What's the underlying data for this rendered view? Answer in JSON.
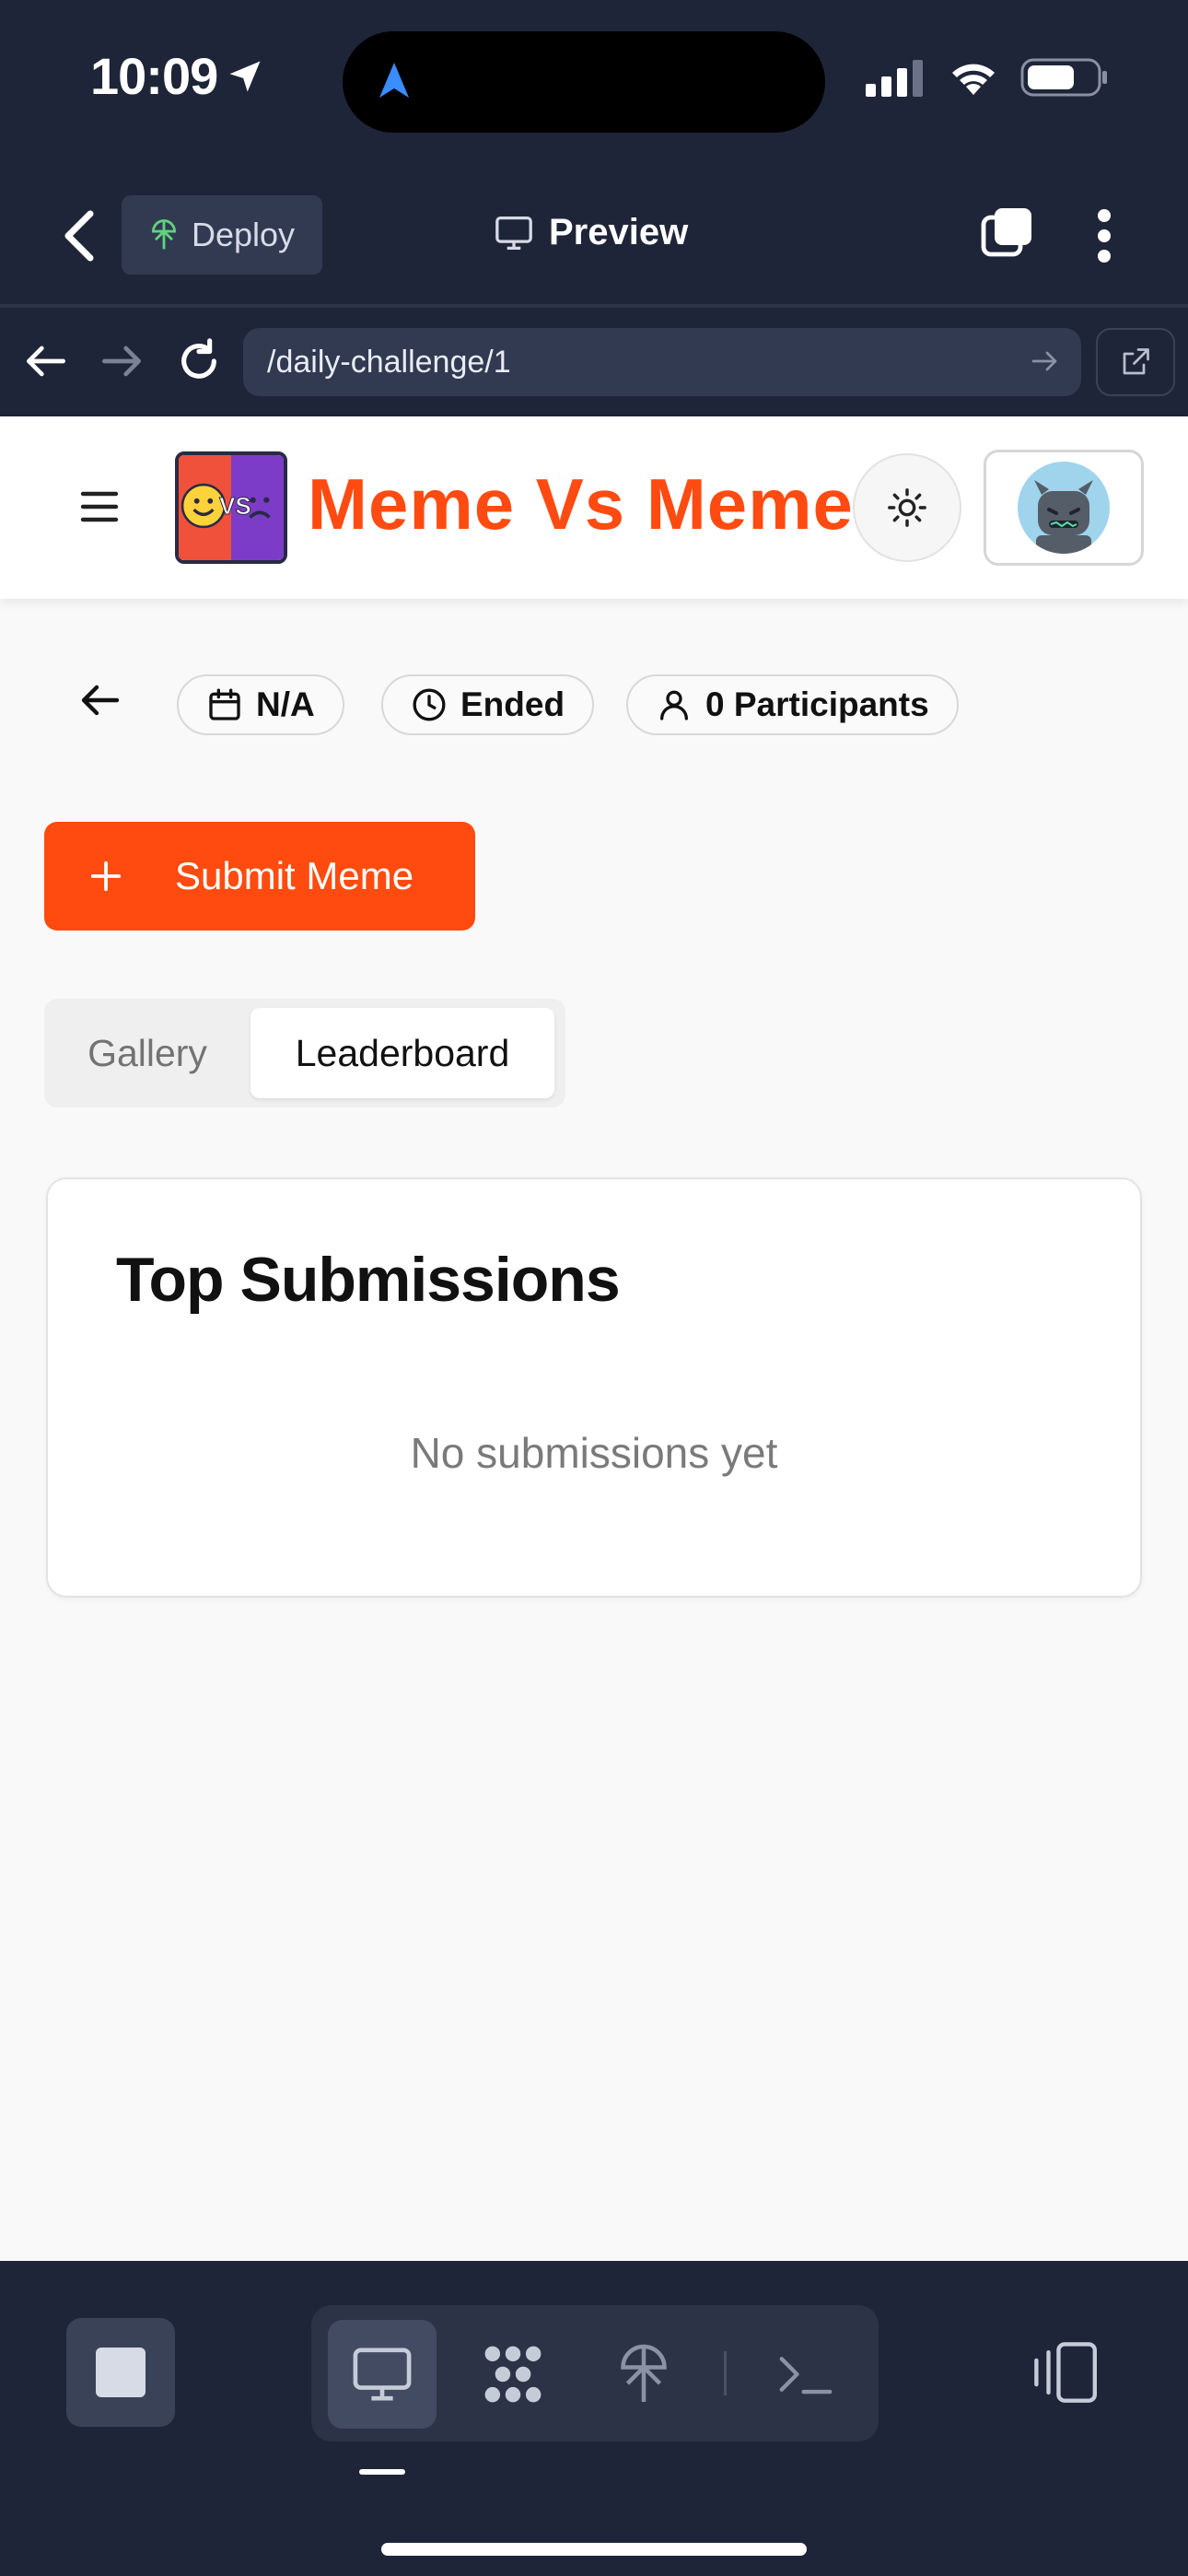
{
  "status_bar": {
    "time": "10:09"
  },
  "top_nav": {
    "deploy_label": "Deploy",
    "preview_label": "Preview"
  },
  "browser": {
    "url": "/daily-challenge/1"
  },
  "app": {
    "brand": "Meme Vs Meme",
    "logo_text": "VS"
  },
  "challenge": {
    "date_chip": "N/A",
    "status_chip": "Ended",
    "participants_chip": "0 Participants",
    "submit_label": "Submit Meme"
  },
  "tabs": {
    "gallery": "Gallery",
    "leaderboard": "Leaderboard",
    "active": "leaderboard"
  },
  "leaderboard_card": {
    "title": "Top Submissions",
    "empty_text": "No submissions yet"
  },
  "colors": {
    "brand_orange": "#ff4b0f",
    "chrome_dark": "#1f2538",
    "logo_red": "#f0513a",
    "logo_purple": "#7d3cc8"
  }
}
